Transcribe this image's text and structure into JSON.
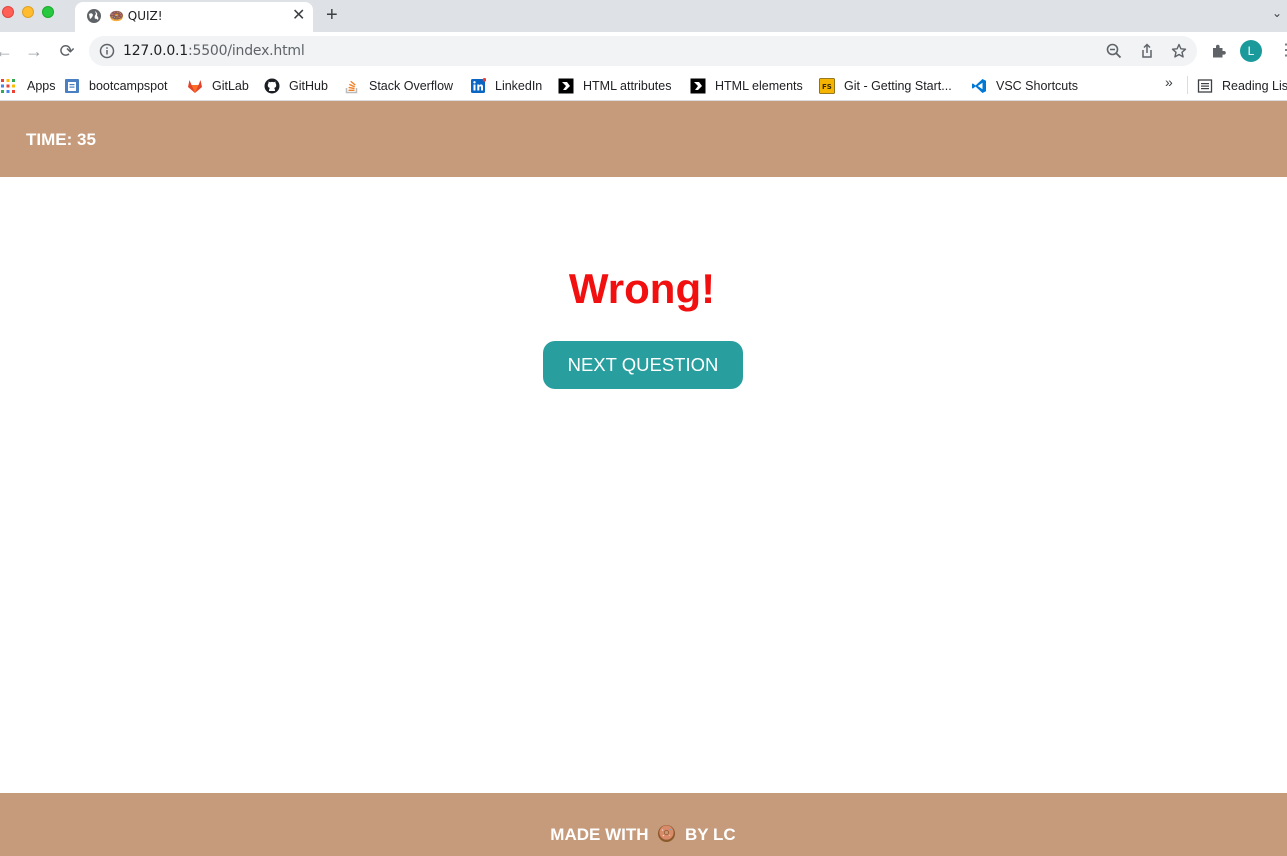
{
  "browser": {
    "tab": {
      "title": "🍩 QUIZ!",
      "close_glyph": "✕",
      "favicon": "globe-icon"
    },
    "new_tab_glyph": "+",
    "tab_menu_glyph": "⌄",
    "nav": {
      "back": "←",
      "forward": "→",
      "reload": "⟳"
    },
    "url": {
      "host": "127.0.0.1",
      "rest": ":5500/index.html"
    },
    "profile_initial": "L",
    "menu_glyph": "⋮"
  },
  "bookmarks": {
    "items": [
      {
        "label": "Apps",
        "icon": "apps-grid-icon"
      },
      {
        "label": "bootcampspot",
        "icon": "bootcampspot-icon"
      },
      {
        "label": "GitLab",
        "icon": "gitlab-icon"
      },
      {
        "label": "GitHub",
        "icon": "github-icon"
      },
      {
        "label": "Stack Overflow",
        "icon": "stackoverflow-icon"
      },
      {
        "label": "LinkedIn",
        "icon": "linkedin-icon"
      },
      {
        "label": "HTML attributes",
        "icon": "bookmark-favicon-icon"
      },
      {
        "label": "HTML elements",
        "icon": "bookmark-favicon-icon"
      },
      {
        "label": "Git - Getting Start...",
        "icon": "fs-icon"
      },
      {
        "label": "VSC Shortcuts",
        "icon": "vscode-icon"
      }
    ],
    "more_glyph": "»",
    "reading_list": "Reading Lis"
  },
  "quiz": {
    "timer": "TIME: 35",
    "result": "Wrong!",
    "result_color": "#f20f0f",
    "next_button": "NEXT QUESTION",
    "footer_before": "MADE WITH",
    "footer_after": "BY LC"
  },
  "colors": {
    "header_bg": "#c69b7b",
    "button_bg": "#289f9e",
    "avatar_bg": "#1a9a9a"
  }
}
